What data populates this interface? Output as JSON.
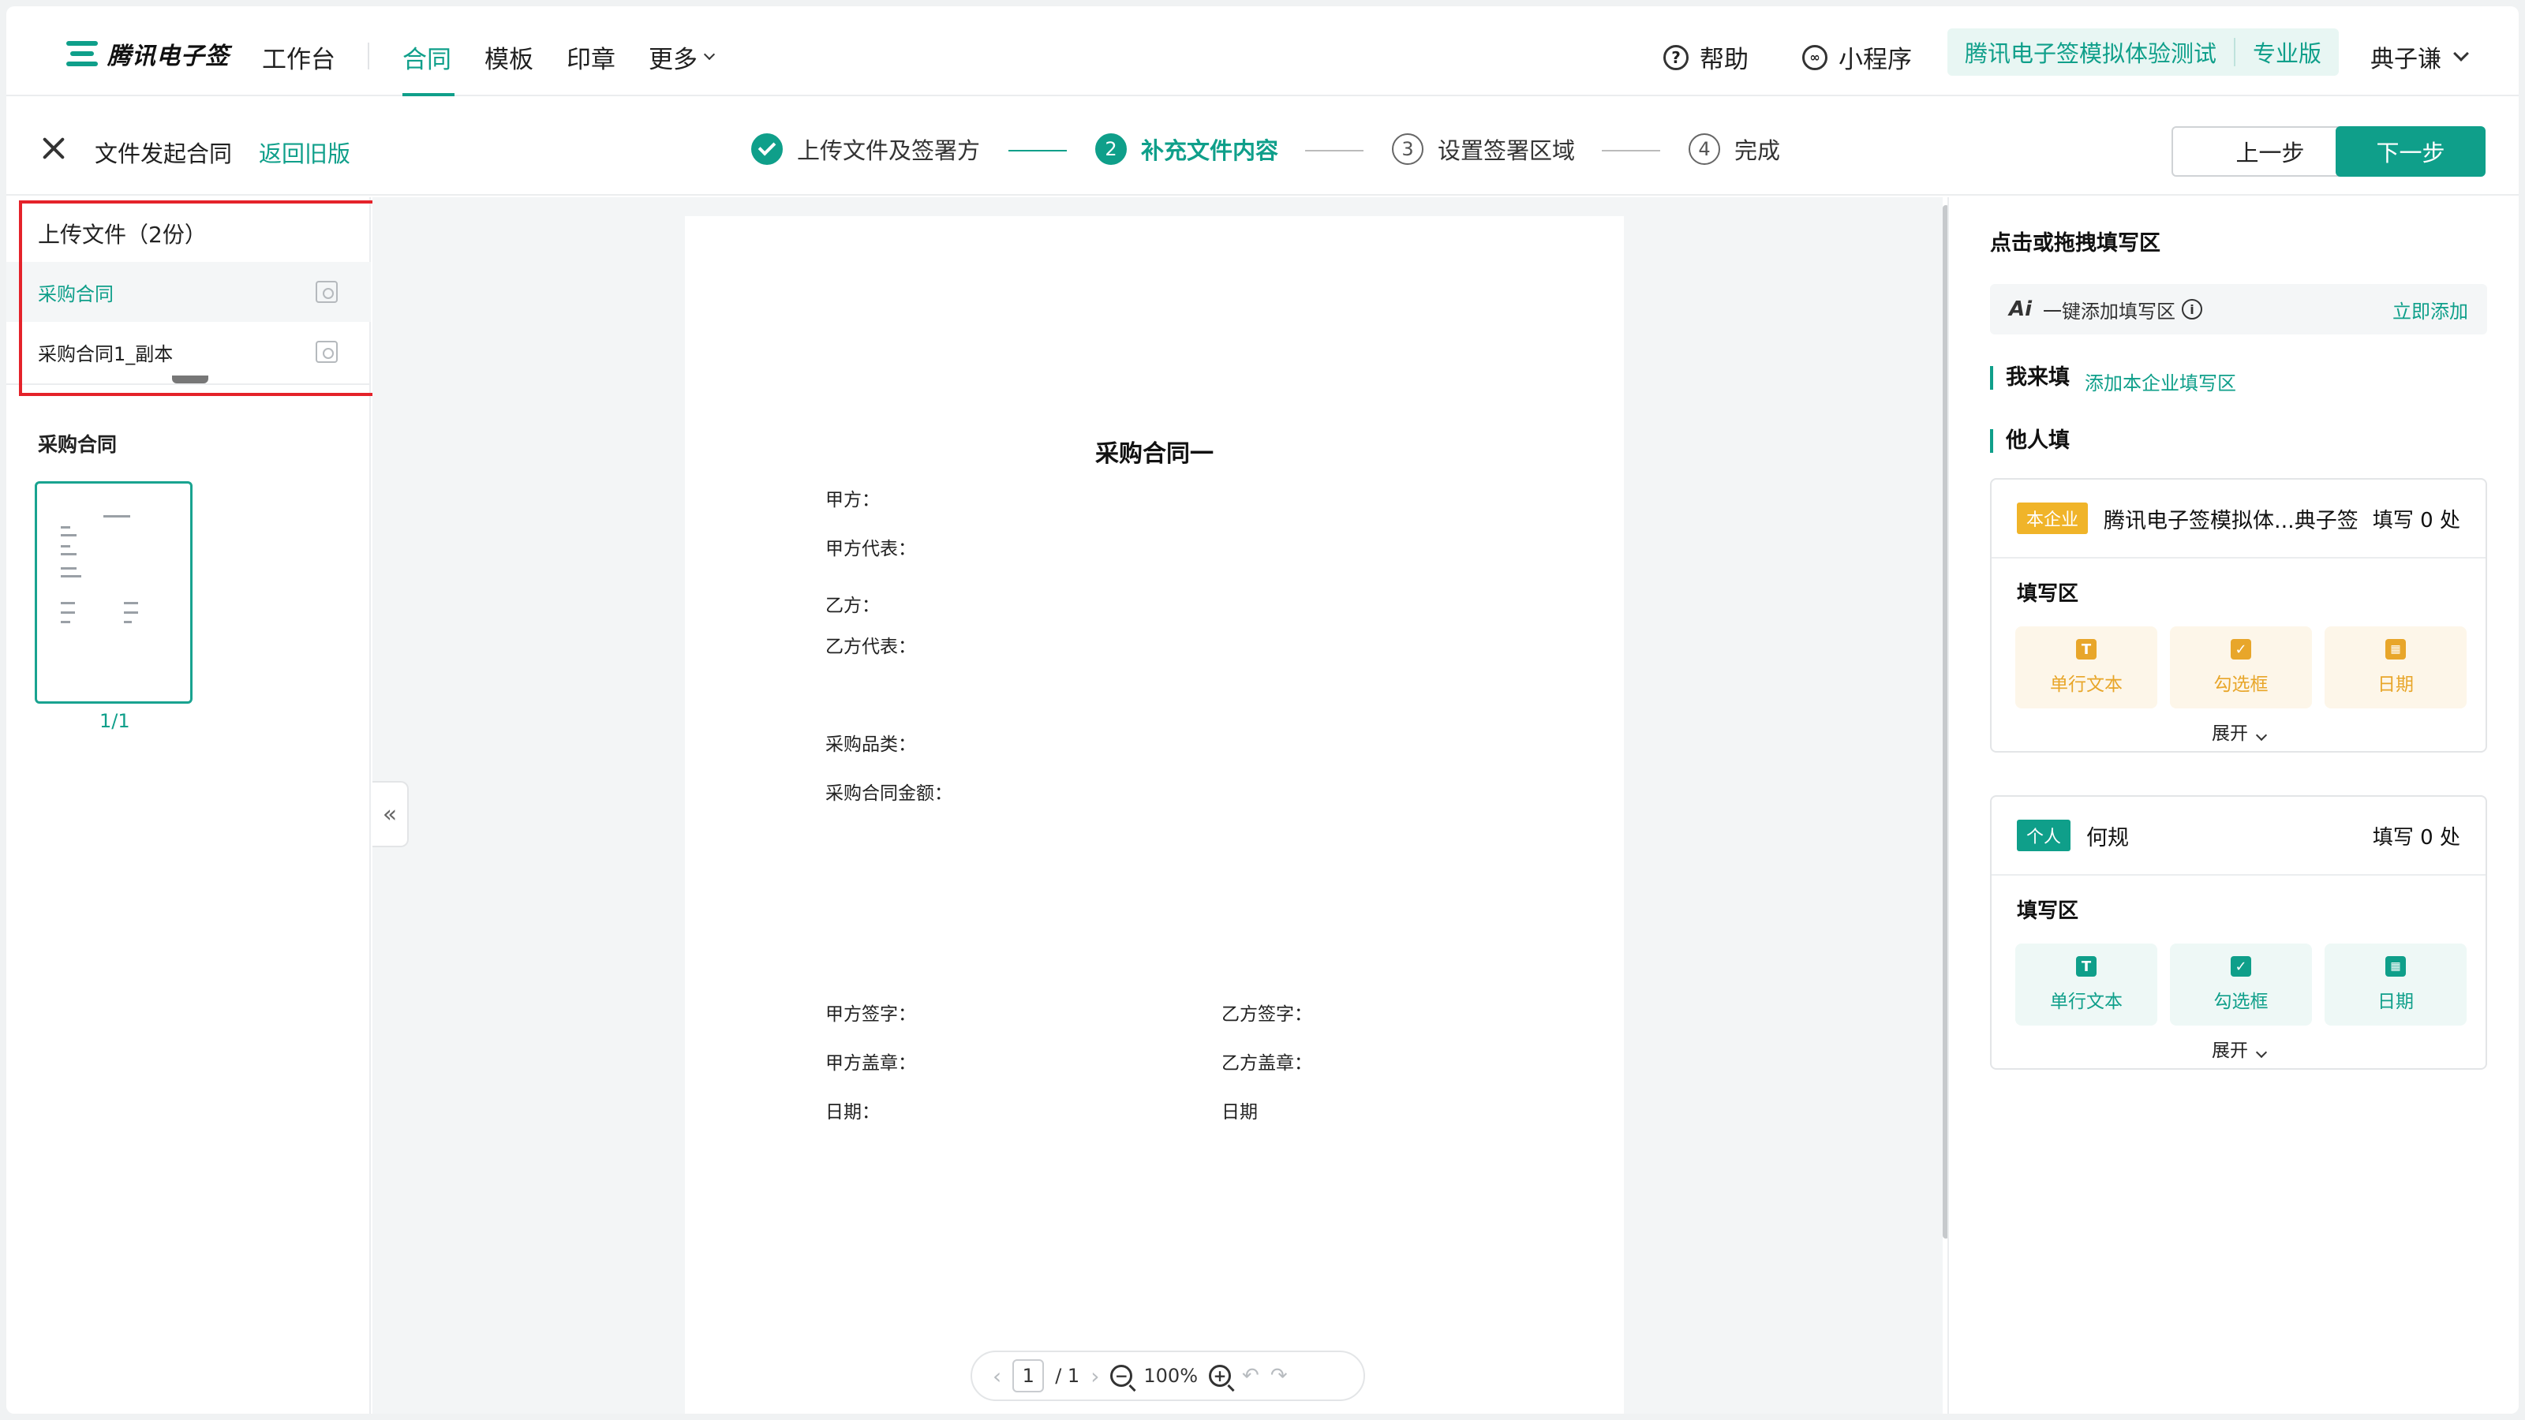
{
  "nav": {
    "brand": "腾讯电子签",
    "items": [
      "工作台",
      "合同",
      "模板",
      "印章",
      "更多"
    ],
    "help": "帮助",
    "mini_program": "小程序",
    "org_name": "腾讯电子签模拟体验测试",
    "org_plan": "专业版",
    "user": "典子谦"
  },
  "subbar": {
    "title": "文件发起合同",
    "back_link": "返回旧版",
    "steps": [
      {
        "num": "",
        "label": "上传文件及签署方",
        "state": "done"
      },
      {
        "num": "2",
        "label": "补充文件内容",
        "state": "current"
      },
      {
        "num": "3",
        "label": "设置签署区域",
        "state": "todo"
      },
      {
        "num": "4",
        "label": "完成",
        "state": "todo"
      }
    ],
    "prev_label": "上一步",
    "next_label": "下一步"
  },
  "left": {
    "upload_head": "上传文件（2份）",
    "files": [
      "采购合同",
      "采购合同1_副本"
    ],
    "thumb_title": "采购合同",
    "thumb_page": "1/1"
  },
  "doc": {
    "title": "采购合同一",
    "party_a": "甲方：",
    "party_a_rep": "甲方代表：",
    "party_b": "乙方：",
    "party_b_rep": "乙方代表：",
    "category": "采购品类：",
    "amount": "采购合同金额：",
    "a_sign": "甲方签字：",
    "a_seal": "甲方盖章：",
    "a_date": "日期：",
    "b_sign": "乙方签字：",
    "b_seal": "乙方盖章：",
    "b_date": "日期"
  },
  "pager": {
    "current": "1",
    "total": "/ 1",
    "zoom": "100%"
  },
  "right": {
    "title": "点击或拖拽填写区",
    "ai_label": "Ai",
    "ai_text": "一键添加填写区",
    "ai_add": "立即添加",
    "self_fill": "我来填",
    "self_link": "添加本企业填写区",
    "others_fill": "他人填",
    "cards": [
      {
        "tag": "本企业",
        "tag_color": "#f0b429",
        "name": "腾讯电子签模拟体...典子签",
        "count": "填写 0 处",
        "sub": "填写区",
        "tool_bg": "#fdf6e9",
        "tool_color": "#e8a62a",
        "tools": [
          "单行文本",
          "勾选框",
          "日期"
        ],
        "expand": "展开"
      },
      {
        "tag": "个人",
        "tag_color": "#0f9f8a",
        "name": "何规",
        "count": "填写 0 处",
        "sub": "填写区",
        "tool_bg": "#eef8f6",
        "tool_color": "#0f9f8a",
        "tools": [
          "单行文本",
          "勾选框",
          "日期"
        ],
        "expand": "展开"
      }
    ]
  }
}
